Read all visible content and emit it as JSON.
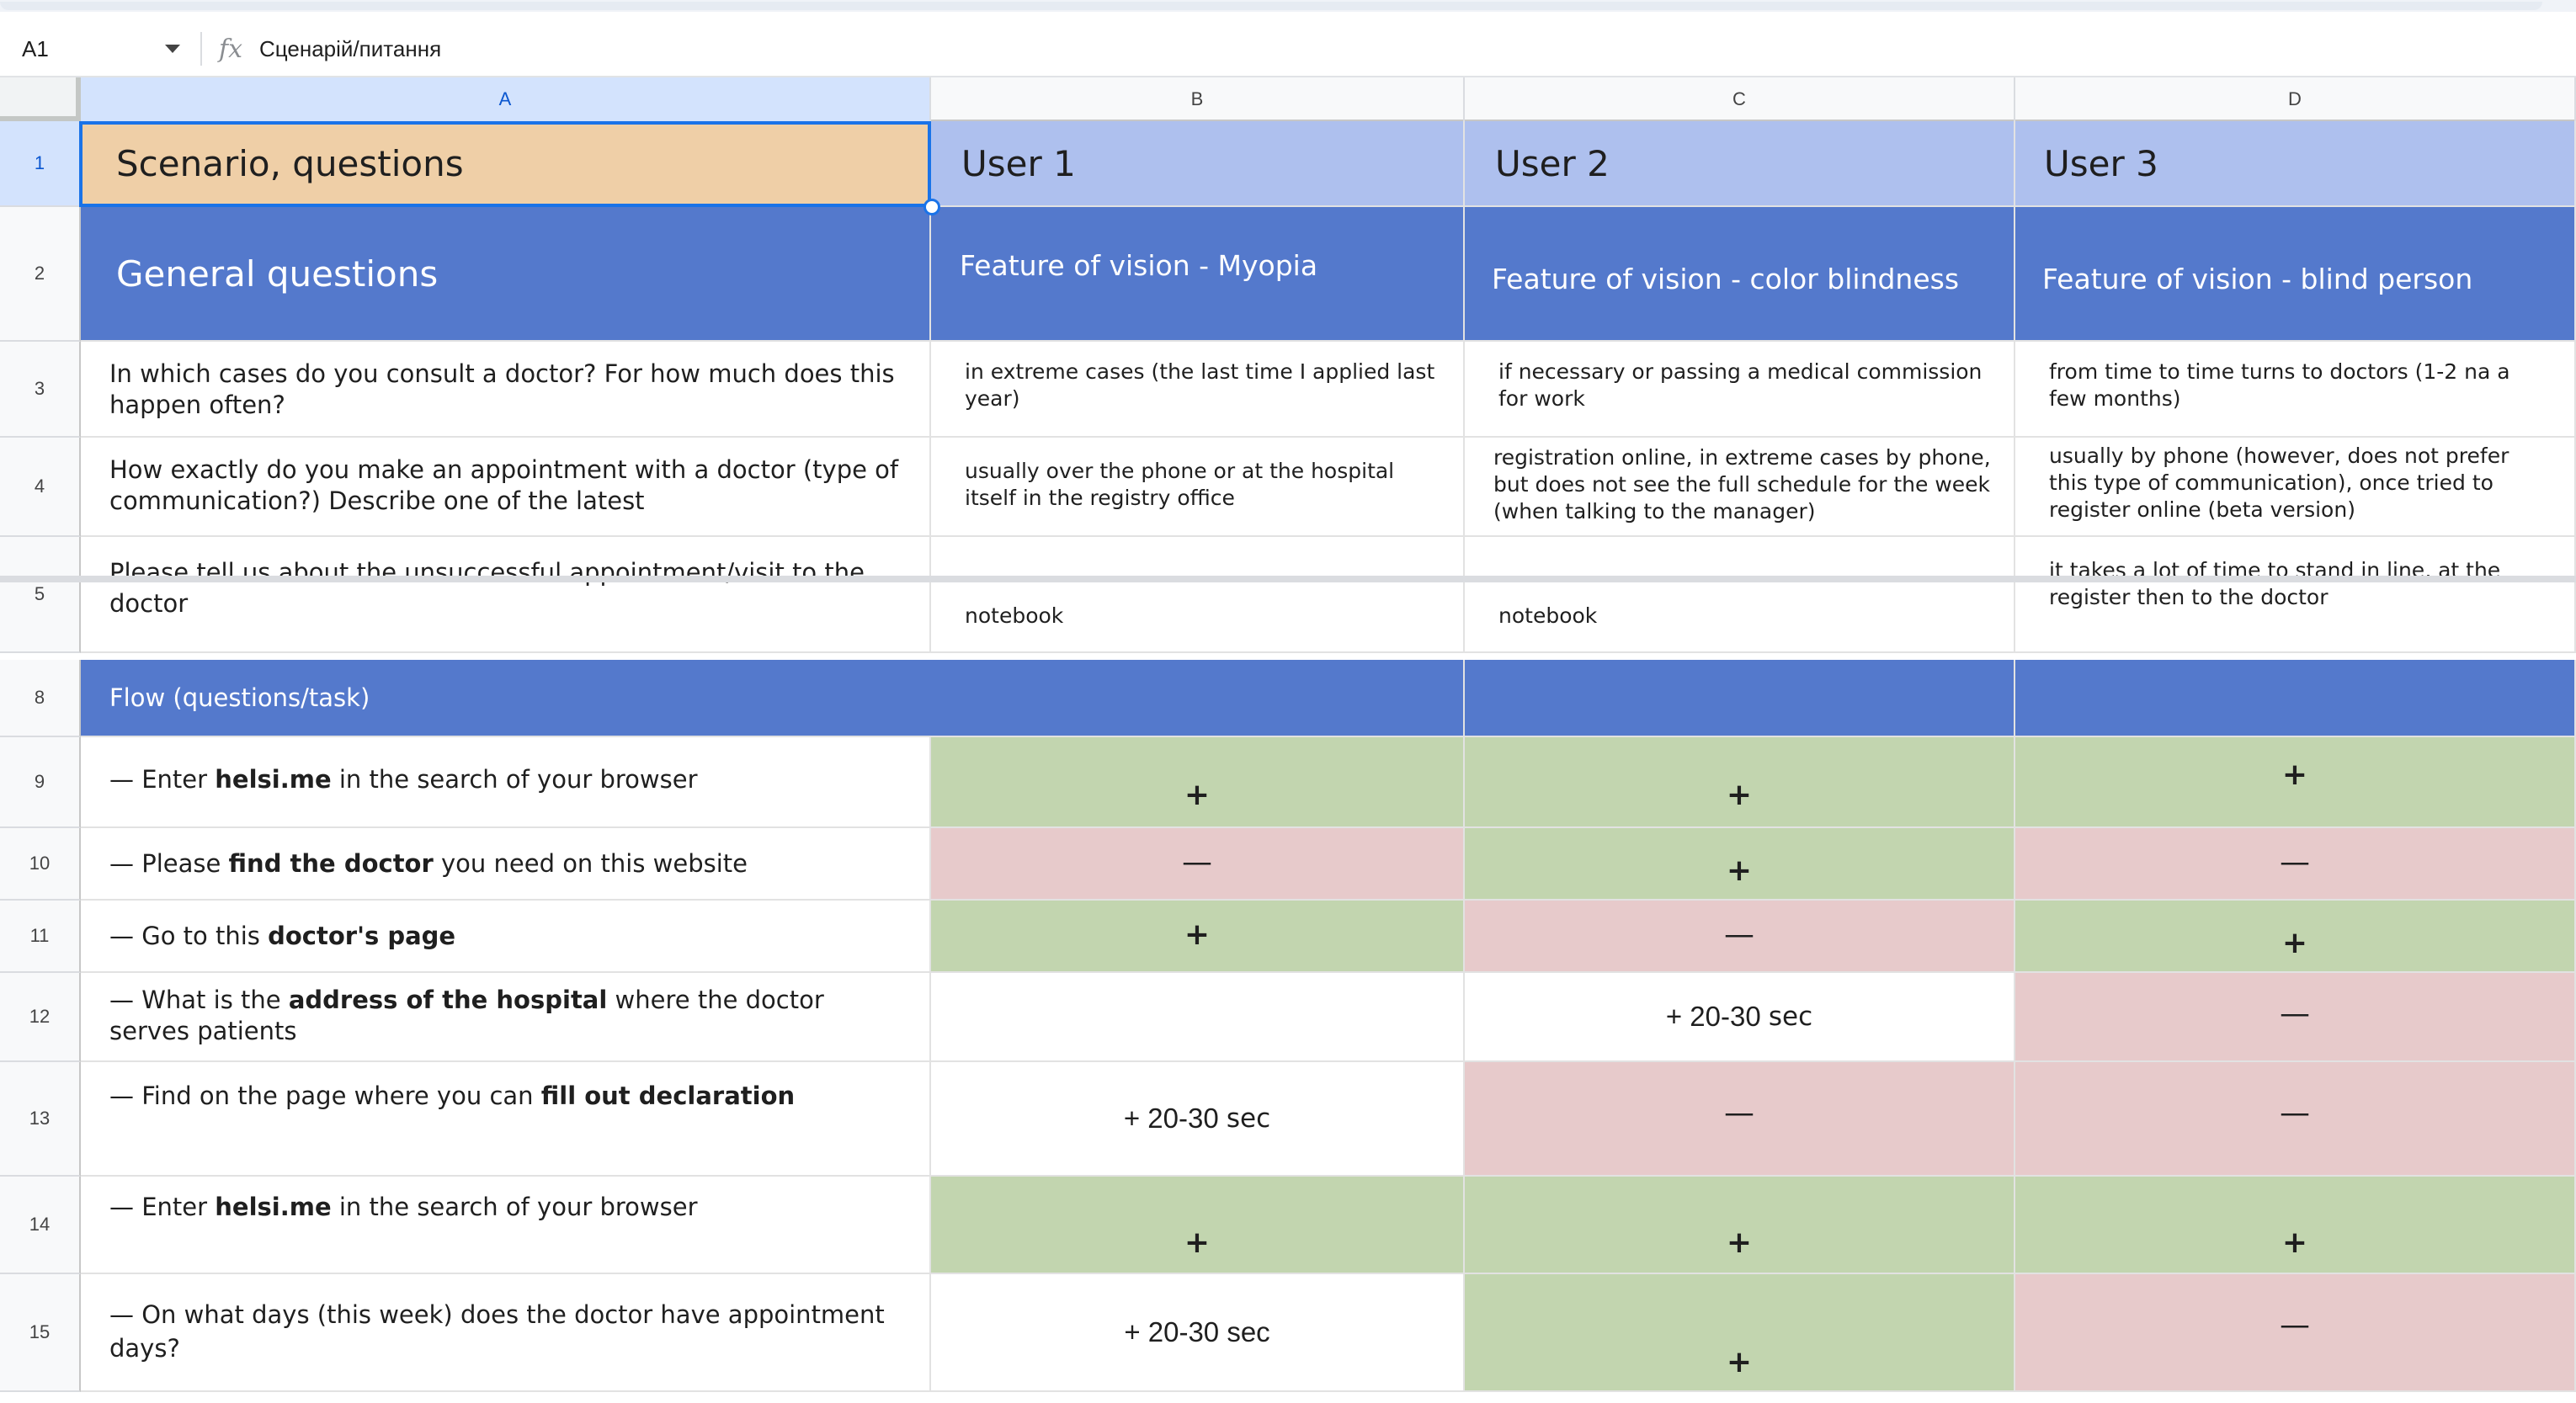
{
  "formula_bar": {
    "cell_ref": "A1",
    "fx_label": "fx",
    "value": "Сценарій/питання"
  },
  "columns": [
    "A",
    "B",
    "C",
    "D"
  ],
  "rows": {
    "r1": {
      "num": "1",
      "a": "Scenario, questions",
      "b": "User 1",
      "c": "User 2",
      "d": "User 3"
    },
    "r2": {
      "num": "2",
      "a": "General questions",
      "b": "Feature of vision - Myopia",
      "c": "Feature of vision - color blindness",
      "d": "Feature of vision - blind person"
    },
    "r3": {
      "num": "3",
      "a": "In which cases do you consult a doctor? For how much does this happen often?",
      "b": "in extreme cases (the last time I applied last year)",
      "c": "if necessary or passing a medical commission for work",
      "d": "from time to time turns to doctors (1-2 na a few months)"
    },
    "r4": {
      "num": "4",
      "a": "How exactly do you make an appointment with a doctor (type of communication?) Describe one of the latest",
      "b": "usually over the phone or at the hospital itself in the registry office",
      "c": "registration online, in extreme cases by phone, but does not see the full schedule for the week (when talking to the manager)",
      "d": "usually by phone (however, does not prefer this type of communication), once tried to register online (beta version)"
    },
    "r5": {
      "num": "5",
      "a": "Please tell us about the unsuccessful appointment/visit to the doctor",
      "b": "notebook",
      "c": "notebook",
      "d": "it takes a lot of time to stand in line, at the register then to the doctor"
    },
    "r8": {
      "num": "8",
      "a": "Flow (questions/task)"
    },
    "r9": {
      "num": "9",
      "pre": "— Enter ",
      "bold": "helsi.me",
      "post": " in the search of your browser",
      "b": "+",
      "c": "+",
      "d": "+"
    },
    "r10": {
      "num": "10",
      "pre": "— Please ",
      "bold": "find the doctor",
      "post": " you need on this website",
      "b": "—",
      "c": "+",
      "d": "—"
    },
    "r11": {
      "num": "11",
      "pre": "— Go to this ",
      "bold": "doctor's page",
      "post": "",
      "b": "+",
      "c": "—",
      "d": "+"
    },
    "r12": {
      "num": "12",
      "pre": "— What is the ",
      "bold": "address of the hospital",
      "post": " where the doctor serves patients",
      "b": "",
      "c_val": "+ 20-30",
      "c_unit": "sec",
      "d": "—"
    },
    "r13": {
      "num": "13",
      "pre": "— Find on the page where you can ",
      "bold": "fill out declaration",
      "post": "",
      "b_val": "+ 20-30",
      "b_unit": "sec",
      "c": "—",
      "d": "—"
    },
    "r14": {
      "num": "14",
      "pre": "— Enter ",
      "bold": "helsi.me",
      "post": " in the search of your browser",
      "b": "+",
      "c": "+",
      "d": "+"
    },
    "r15": {
      "num": "15",
      "a": "— On what days (this week) does the doctor have appointment days?",
      "b": "+ 20-30 sec",
      "c": "+",
      "d": "—"
    }
  },
  "colors": {
    "title_peach": "#efcfa7",
    "user_lavender": "#aec0ee",
    "section_blue": "#5479cc",
    "pass_green": "#c2d5af",
    "fail_pink": "#e7cacb",
    "selection_blue": "#1a73e8"
  }
}
